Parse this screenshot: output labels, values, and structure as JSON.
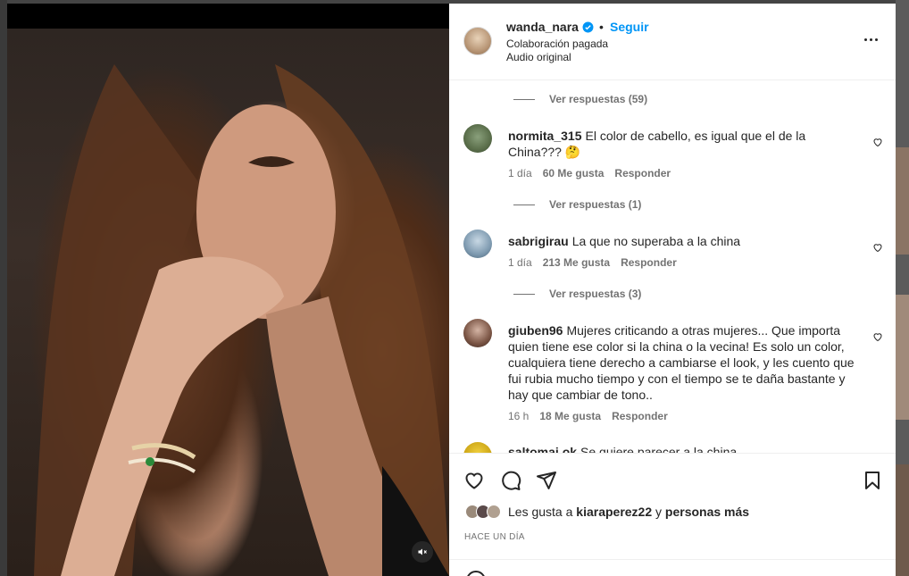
{
  "post": {
    "username": "wanda_nara",
    "follow_label": "Seguir",
    "dot": "•",
    "paid_partnership": "Colaboración pagada",
    "audio": "Audio original"
  },
  "comments": [
    {
      "type": "replies",
      "label": "Ver respuestas (59)"
    },
    {
      "type": "comment",
      "username": "normita_315",
      "text": "El color de cabello, es igual que el de la China??? 🤔",
      "age": "1 día",
      "likes": "60 Me gusta",
      "reply": "Responder"
    },
    {
      "type": "replies",
      "label": "Ver respuestas (1)"
    },
    {
      "type": "comment",
      "username": "sabrigirau",
      "text": "La que no superaba a la china",
      "age": "1 día",
      "likes": "213 Me gusta",
      "reply": "Responder"
    },
    {
      "type": "replies",
      "label": "Ver respuestas (3)"
    },
    {
      "type": "comment",
      "username": "giuben96",
      "text": "Mujeres criticando a otras mujeres... Que importa quien tiene ese color si la china o la vecina! Es solo un color, cualquiera tiene derecho a cambiarse el look, y les cuento que fui rubia mucho tiempo y con el tiempo se te daña bastante y hay que cambiar de tono..",
      "age": "16 h",
      "likes": "18 Me gusta",
      "reply": "Responder"
    },
    {
      "type": "comment",
      "username": "saltomai.ok",
      "text": "Se quiere parecer a la china",
      "partial": true
    }
  ],
  "likes": {
    "prefix": "Les gusta a",
    "user": "kiaraperez22",
    "connector": "y",
    "others": "personas más"
  },
  "timestamp": "HACE UN DÍA",
  "icons": {
    "verified": "verified-badge-icon",
    "more": "more-options-icon",
    "like": "heart-icon",
    "comment": "comment-icon",
    "share": "share-icon",
    "save": "bookmark-icon",
    "mute": "muted-audio-icon"
  },
  "colors": {
    "accent": "#0095f6",
    "text": "#262626",
    "secondary": "#737373"
  }
}
